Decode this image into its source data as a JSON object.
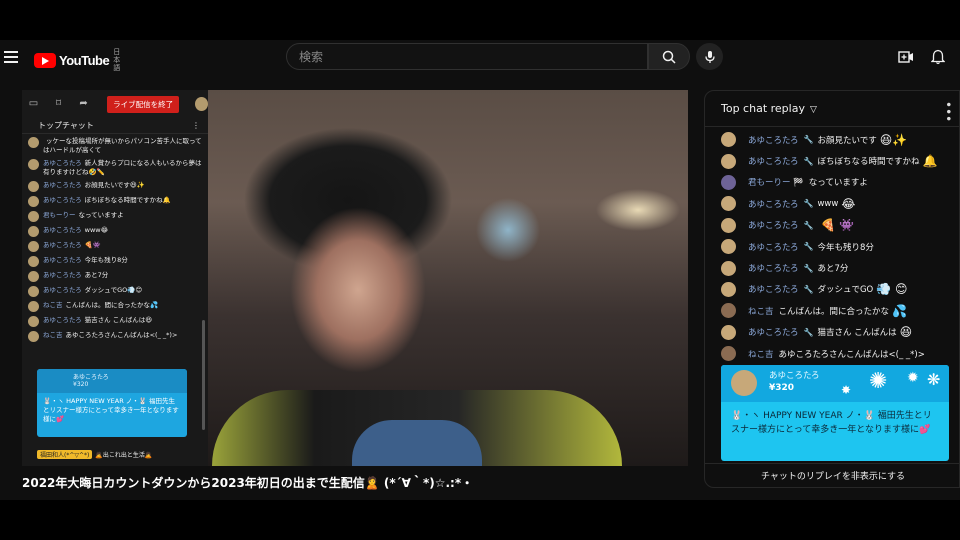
{
  "header": {
    "logo_text": "YouTube",
    "region": "日本語",
    "search_placeholder": "検索"
  },
  "overlay_chat": {
    "end_button": "ライブ配信を終了",
    "title": "トップチャット",
    "messages": [
      {
        "author": "",
        "text": "ッケーな投稿場所が無いからパソコン苦手人に取ってはハードルが高くて"
      },
      {
        "author": "あゆころたろ",
        "text": "新人賞からプロになる人もいるから夢は有りますけどね🤣✏️"
      },
      {
        "author": "あゆころたろ",
        "text": "お顔見たいです😆✨"
      },
      {
        "author": "あゆころたろ",
        "text": "ぼちぼちなる時間ですかね🔔"
      },
      {
        "author": "君もーりー",
        "text": "なっていますよ"
      },
      {
        "author": "あゆころたろ",
        "text": "www😂"
      },
      {
        "author": "あゆころたろ",
        "text": "🍕👾"
      },
      {
        "author": "あゆころたろ",
        "text": "今年も残り8分"
      },
      {
        "author": "あゆころたろ",
        "text": "あと7分"
      },
      {
        "author": "あゆころたろ",
        "text": "ダッシュでGO💨😊"
      },
      {
        "author": "ねこ吉",
        "text": "こんばんは。間に合ったかな💦"
      },
      {
        "author": "あゆころたろ",
        "text": "猫吉さん こんばんは😆"
      },
      {
        "author": "ねこ吉",
        "text": "あゆころたろさんこんばんは<(_ _*)>"
      }
    ],
    "superchat": {
      "author": "あゆころたろ",
      "amount": "¥320",
      "text": "🐰・ヽ HAPPY NEW YEAR ノ・🐰 福田先生とリスナー様方にとって幸多き一年となります様に💕"
    },
    "bottom_tag": "福田和人(*^▽^*)",
    "bottom_text": "🙇出これ出と生活🙇"
  },
  "video": {
    "title": "2022年大晦日カウントダウンから2023年初日の出まで生配信🙎 (*´∀｀*)☆.:*・"
  },
  "chat": {
    "header": "Top chat replay",
    "messages": [
      {
        "author": "あゆころたろ",
        "text": "お顔見たいです",
        "emoji": "😆✨",
        "avatar": "gold"
      },
      {
        "author": "あゆころたろ",
        "text": "ぼちぼちなる時間ですかね",
        "emoji": "🔔",
        "avatar": "gold"
      },
      {
        "author": "君もーりー 🏁",
        "text": "なっていますよ",
        "emoji": "",
        "avatar": "purple"
      },
      {
        "author": "あゆころたろ",
        "text": "www",
        "emoji": "😂",
        "avatar": "gold"
      },
      {
        "author": "あゆころたろ",
        "text": "",
        "emoji": "🍕 👾",
        "avatar": "gold"
      },
      {
        "author": "あゆころたろ",
        "text": "今年も残り8分",
        "emoji": "",
        "avatar": "gold"
      },
      {
        "author": "あゆころたろ",
        "text": "あと7分",
        "emoji": "",
        "avatar": "gold"
      },
      {
        "author": "あゆころたろ",
        "text": "ダッシュでGO",
        "emoji": "💨 😊",
        "avatar": "gold"
      },
      {
        "author": "ねこ吉",
        "text": "こんばんは。間に合ったかな",
        "emoji": "💦",
        "avatar": "brown"
      },
      {
        "author": "あゆころたろ",
        "text": "猫吉さん こんばんは",
        "emoji": "😆",
        "avatar": "gold"
      },
      {
        "author": "ねこ吉",
        "text": "あゆころたろさんこんばんは<(_ _*)>",
        "emoji": "",
        "avatar": "brown"
      }
    ],
    "superchat": {
      "author": "あゆころたろ",
      "amount": "¥320",
      "text": "🐰・ヽ HAPPY NEW YEAR ノ・🐰 福田先生とリスナー様方にとって幸多き一年となります様に💕"
    },
    "footer": "チャットのリプレイを非表示にする"
  },
  "colors": {
    "brand_red": "#ff0000",
    "superchat_blue": "#1ec5f0",
    "author_blue": "#8aa6d6"
  }
}
